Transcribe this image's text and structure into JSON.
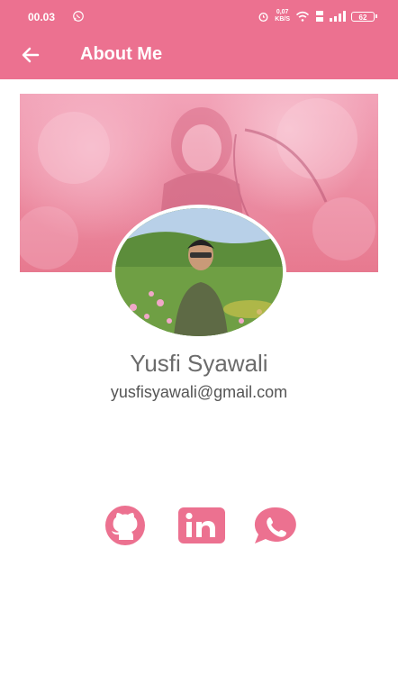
{
  "status_bar": {
    "time": "00.03",
    "speed_value": "0,07",
    "speed_unit": "KB/S",
    "battery": "62"
  },
  "toolbar": {
    "back_icon": "arrow-left-icon",
    "title": "About Me"
  },
  "profile": {
    "name": "Yusfi Syawali",
    "email": "yusfisyawali@gmail.com"
  },
  "social_links": [
    {
      "icon": "github-icon",
      "color": "#ec7190"
    },
    {
      "icon": "linkedin-icon",
      "color": "#ec7190"
    },
    {
      "icon": "whatsapp-icon",
      "color": "#ec7190"
    }
  ],
  "colors": {
    "primary": "#ec7190",
    "text_name": "#6b6b6b",
    "text_email": "#555555"
  }
}
